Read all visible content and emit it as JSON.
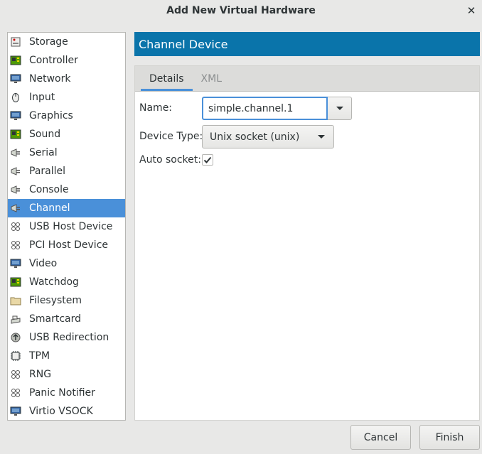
{
  "window": {
    "title": "Add New Virtual Hardware"
  },
  "sidebar": {
    "items": [
      {
        "label": "Storage",
        "icon": "storage-icon"
      },
      {
        "label": "Controller",
        "icon": "controller-icon"
      },
      {
        "label": "Network",
        "icon": "network-icon"
      },
      {
        "label": "Input",
        "icon": "mouse-icon"
      },
      {
        "label": "Graphics",
        "icon": "monitor-icon"
      },
      {
        "label": "Sound",
        "icon": "sound-card-icon"
      },
      {
        "label": "Serial",
        "icon": "serial-plug-icon"
      },
      {
        "label": "Parallel",
        "icon": "parallel-plug-icon"
      },
      {
        "label": "Console",
        "icon": "console-plug-icon"
      },
      {
        "label": "Channel",
        "icon": "channel-plug-icon",
        "selected": true
      },
      {
        "label": "USB Host Device",
        "icon": "usb-device-icon"
      },
      {
        "label": "PCI Host Device",
        "icon": "pci-device-icon"
      },
      {
        "label": "Video",
        "icon": "video-monitor-icon"
      },
      {
        "label": "Watchdog",
        "icon": "watchdog-board-icon"
      },
      {
        "label": "Filesystem",
        "icon": "folder-icon"
      },
      {
        "label": "Smartcard",
        "icon": "smartcard-icon"
      },
      {
        "label": "USB Redirection",
        "icon": "usb-redirection-icon"
      },
      {
        "label": "TPM",
        "icon": "chip-icon"
      },
      {
        "label": "RNG",
        "icon": "rng-icon"
      },
      {
        "label": "Panic Notifier",
        "icon": "panic-notifier-icon"
      },
      {
        "label": "Virtio VSOCK",
        "icon": "vsock-monitor-icon"
      }
    ]
  },
  "header": {
    "title": "Channel Device"
  },
  "tabs": [
    {
      "label": "Details",
      "active": true
    },
    {
      "label": "XML",
      "active": false
    }
  ],
  "form": {
    "name_label": "Name:",
    "name_value": "simple.channel.1",
    "device_type_label": "Device Type:",
    "device_type_value": "Unix socket (unix)",
    "auto_socket_label": "Auto socket:",
    "auto_socket_checked": true
  },
  "buttons": {
    "cancel": "Cancel",
    "finish": "Finish"
  },
  "colors": {
    "selection": "#4a90d9",
    "header": "#0a74aa",
    "focus": "#4a90d9"
  }
}
